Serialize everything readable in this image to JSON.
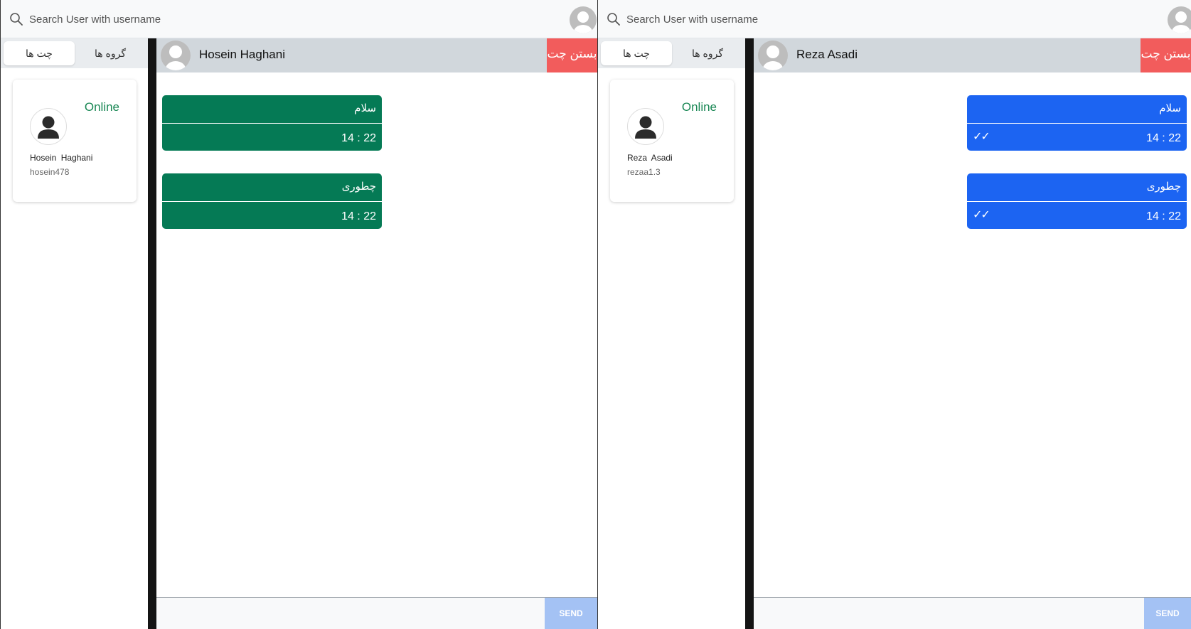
{
  "search": {
    "placeholder": "Search User with username"
  },
  "sidebar": {
    "tab_chats": "چت ها",
    "tab_groups": "گروه ها"
  },
  "colors": {
    "incoming": "#057a55",
    "outgoing": "#1c64f2",
    "close": "#f25c5c",
    "online": "#198754",
    "send": "#a4c2f4"
  },
  "window1": {
    "contact": {
      "status": "Online",
      "name": "Hosein  Haghani",
      "username": "hosein478"
    },
    "chat": {
      "name": "Hosein Haghani",
      "close_label": "بستن چت",
      "messages": [
        {
          "text": "سلام",
          "time": "14 : 22",
          "direction": "incoming"
        },
        {
          "text": "چطوری",
          "time": "14 : 22",
          "direction": "incoming"
        }
      ],
      "send_label": "SEND"
    }
  },
  "window2": {
    "contact": {
      "status": "Online",
      "name": "Reza  Asadi",
      "username": "rezaa1.3"
    },
    "chat": {
      "name": "Reza Asadi",
      "close_label": "بستن چت",
      "messages": [
        {
          "text": "سلام",
          "time": "14 : 22",
          "ticks": "✓✓",
          "direction": "outgoing"
        },
        {
          "text": "چطوری",
          "time": "14 : 22",
          "ticks": "✓✓",
          "direction": "outgoing"
        }
      ],
      "send_label": "SEND"
    }
  }
}
